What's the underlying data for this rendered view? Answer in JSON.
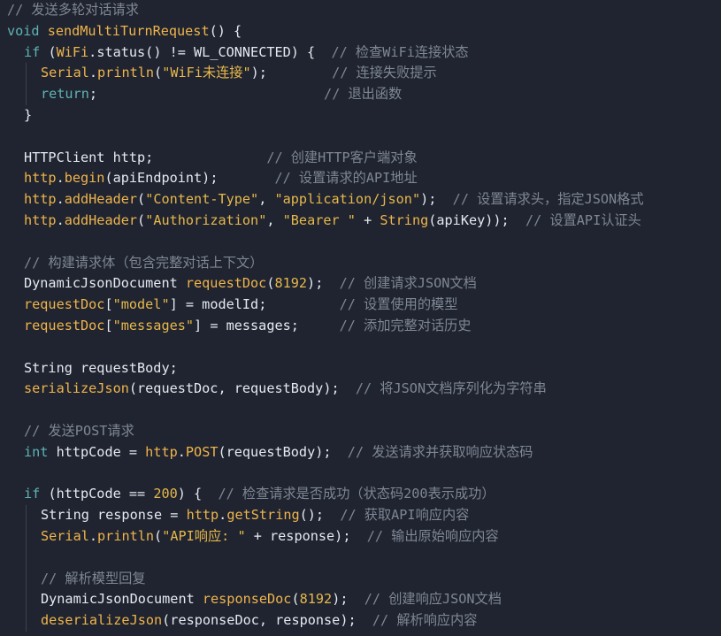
{
  "editor": {
    "lines": [
      {
        "indent": 0,
        "tokens": [
          {
            "t": "// 发送多轮对话请求",
            "c": "comment"
          }
        ]
      },
      {
        "indent": 0,
        "tokens": [
          {
            "t": "void ",
            "c": "keyword"
          },
          {
            "t": "sendMultiTurnRequest",
            "c": "func"
          },
          {
            "t": "() {",
            "c": "plain"
          }
        ]
      },
      {
        "indent": 1,
        "tokens": [
          {
            "t": "if",
            "c": "keyword"
          },
          {
            "t": " (",
            "c": "plain"
          },
          {
            "t": "WiFi",
            "c": "obj"
          },
          {
            "t": ".status() != WL_CONNECTED) {  ",
            "c": "plain"
          },
          {
            "t": "// 检查WiFi连接状态",
            "c": "comment"
          }
        ]
      },
      {
        "indent": 2,
        "tokens": [
          {
            "t": "Serial",
            "c": "obj"
          },
          {
            "t": ".",
            "c": "plain"
          },
          {
            "t": "println",
            "c": "func"
          },
          {
            "t": "(",
            "c": "plain"
          },
          {
            "t": "\"WiFi未连接\"",
            "c": "str"
          },
          {
            "t": ");        ",
            "c": "plain"
          },
          {
            "t": "// 连接失败提示",
            "c": "comment"
          }
        ]
      },
      {
        "indent": 2,
        "tokens": [
          {
            "t": "return",
            "c": "keyword"
          },
          {
            "t": ";                            ",
            "c": "plain"
          },
          {
            "t": "// 退出函数",
            "c": "comment"
          }
        ]
      },
      {
        "indent": 1,
        "tokens": [
          {
            "t": "}",
            "c": "plain"
          }
        ]
      },
      {
        "indent": 1,
        "tokens": []
      },
      {
        "indent": 1,
        "tokens": [
          {
            "t": "HTTPClient http;              ",
            "c": "plain"
          },
          {
            "t": "// 创建HTTP客户端对象",
            "c": "comment"
          }
        ]
      },
      {
        "indent": 1,
        "tokens": [
          {
            "t": "http",
            "c": "obj"
          },
          {
            "t": ".",
            "c": "plain"
          },
          {
            "t": "begin",
            "c": "func"
          },
          {
            "t": "(apiEndpoint);       ",
            "c": "plain"
          },
          {
            "t": "// 设置请求的API地址",
            "c": "comment"
          }
        ]
      },
      {
        "indent": 1,
        "tokens": [
          {
            "t": "http",
            "c": "obj"
          },
          {
            "t": ".",
            "c": "plain"
          },
          {
            "t": "addHeader",
            "c": "func"
          },
          {
            "t": "(",
            "c": "plain"
          },
          {
            "t": "\"Content-Type\"",
            "c": "str"
          },
          {
            "t": ", ",
            "c": "plain"
          },
          {
            "t": "\"application/json\"",
            "c": "str"
          },
          {
            "t": ");  ",
            "c": "plain"
          },
          {
            "t": "// 设置请求头，指定JSON格式",
            "c": "comment"
          }
        ]
      },
      {
        "indent": 1,
        "tokens": [
          {
            "t": "http",
            "c": "obj"
          },
          {
            "t": ".",
            "c": "plain"
          },
          {
            "t": "addHeader",
            "c": "func"
          },
          {
            "t": "(",
            "c": "plain"
          },
          {
            "t": "\"Authorization\"",
            "c": "str"
          },
          {
            "t": ", ",
            "c": "plain"
          },
          {
            "t": "\"Bearer \"",
            "c": "str"
          },
          {
            "t": " + ",
            "c": "plain"
          },
          {
            "t": "String",
            "c": "func"
          },
          {
            "t": "(apiKey));  ",
            "c": "plain"
          },
          {
            "t": "// 设置API认证头",
            "c": "comment"
          }
        ]
      },
      {
        "indent": 1,
        "tokens": []
      },
      {
        "indent": 1,
        "tokens": [
          {
            "t": "// 构建请求体（包含完整对话上下文）",
            "c": "comment"
          }
        ]
      },
      {
        "indent": 1,
        "tokens": [
          {
            "t": "DynamicJsonDocument ",
            "c": "plain"
          },
          {
            "t": "requestDoc",
            "c": "func"
          },
          {
            "t": "(",
            "c": "plain"
          },
          {
            "t": "8192",
            "c": "num"
          },
          {
            "t": ");  ",
            "c": "plain"
          },
          {
            "t": "// 创建请求JSON文档",
            "c": "comment"
          }
        ]
      },
      {
        "indent": 1,
        "tokens": [
          {
            "t": "requestDoc",
            "c": "obj"
          },
          {
            "t": "[",
            "c": "plain"
          },
          {
            "t": "\"model\"",
            "c": "str"
          },
          {
            "t": "] = modelId;         ",
            "c": "plain"
          },
          {
            "t": "// 设置使用的模型",
            "c": "comment"
          }
        ]
      },
      {
        "indent": 1,
        "tokens": [
          {
            "t": "requestDoc",
            "c": "obj"
          },
          {
            "t": "[",
            "c": "plain"
          },
          {
            "t": "\"messages\"",
            "c": "str"
          },
          {
            "t": "] = messages;     ",
            "c": "plain"
          },
          {
            "t": "// 添加完整对话历史",
            "c": "comment"
          }
        ]
      },
      {
        "indent": 1,
        "tokens": []
      },
      {
        "indent": 1,
        "tokens": [
          {
            "t": "String requestBody;",
            "c": "plain"
          }
        ]
      },
      {
        "indent": 1,
        "tokens": [
          {
            "t": "serializeJson",
            "c": "func"
          },
          {
            "t": "(requestDoc, requestBody);  ",
            "c": "plain"
          },
          {
            "t": "// 将JSON文档序列化为字符串",
            "c": "comment"
          }
        ]
      },
      {
        "indent": 1,
        "tokens": []
      },
      {
        "indent": 1,
        "tokens": [
          {
            "t": "// 发送POST请求",
            "c": "comment"
          }
        ]
      },
      {
        "indent": 1,
        "tokens": [
          {
            "t": "int",
            "c": "keyword"
          },
          {
            "t": " httpCode = ",
            "c": "plain"
          },
          {
            "t": "http",
            "c": "obj"
          },
          {
            "t": ".",
            "c": "plain"
          },
          {
            "t": "POST",
            "c": "func"
          },
          {
            "t": "(requestBody);  ",
            "c": "plain"
          },
          {
            "t": "// 发送请求并获取响应状态码",
            "c": "comment"
          }
        ]
      },
      {
        "indent": 1,
        "tokens": []
      },
      {
        "indent": 1,
        "tokens": [
          {
            "t": "if",
            "c": "keyword"
          },
          {
            "t": " (httpCode == ",
            "c": "plain"
          },
          {
            "t": "200",
            "c": "num"
          },
          {
            "t": ") {  ",
            "c": "plain"
          },
          {
            "t": "// 检查请求是否成功（状态码200表示成功）",
            "c": "comment"
          }
        ]
      },
      {
        "indent": 2,
        "tokens": [
          {
            "t": "String response = ",
            "c": "plain"
          },
          {
            "t": "http",
            "c": "obj"
          },
          {
            "t": ".",
            "c": "plain"
          },
          {
            "t": "getString",
            "c": "func"
          },
          {
            "t": "();  ",
            "c": "plain"
          },
          {
            "t": "// 获取API响应内容",
            "c": "comment"
          }
        ]
      },
      {
        "indent": 2,
        "tokens": [
          {
            "t": "Serial",
            "c": "obj"
          },
          {
            "t": ".",
            "c": "plain"
          },
          {
            "t": "println",
            "c": "func"
          },
          {
            "t": "(",
            "c": "plain"
          },
          {
            "t": "\"API响应: \"",
            "c": "str"
          },
          {
            "t": " + response);  ",
            "c": "plain"
          },
          {
            "t": "// 输出原始响应内容",
            "c": "comment"
          }
        ]
      },
      {
        "indent": 2,
        "tokens": []
      },
      {
        "indent": 2,
        "tokens": [
          {
            "t": "// 解析模型回复",
            "c": "comment"
          }
        ]
      },
      {
        "indent": 2,
        "tokens": [
          {
            "t": "DynamicJsonDocument ",
            "c": "plain"
          },
          {
            "t": "responseDoc",
            "c": "func"
          },
          {
            "t": "(",
            "c": "plain"
          },
          {
            "t": "8192",
            "c": "num"
          },
          {
            "t": ");  ",
            "c": "plain"
          },
          {
            "t": "// 创建响应JSON文档",
            "c": "comment"
          }
        ]
      },
      {
        "indent": 2,
        "tokens": [
          {
            "t": "deserializeJson",
            "c": "func"
          },
          {
            "t": "(responseDoc, response);  ",
            "c": "plain"
          },
          {
            "t": "// 解析响应内容",
            "c": "comment"
          }
        ]
      }
    ]
  }
}
